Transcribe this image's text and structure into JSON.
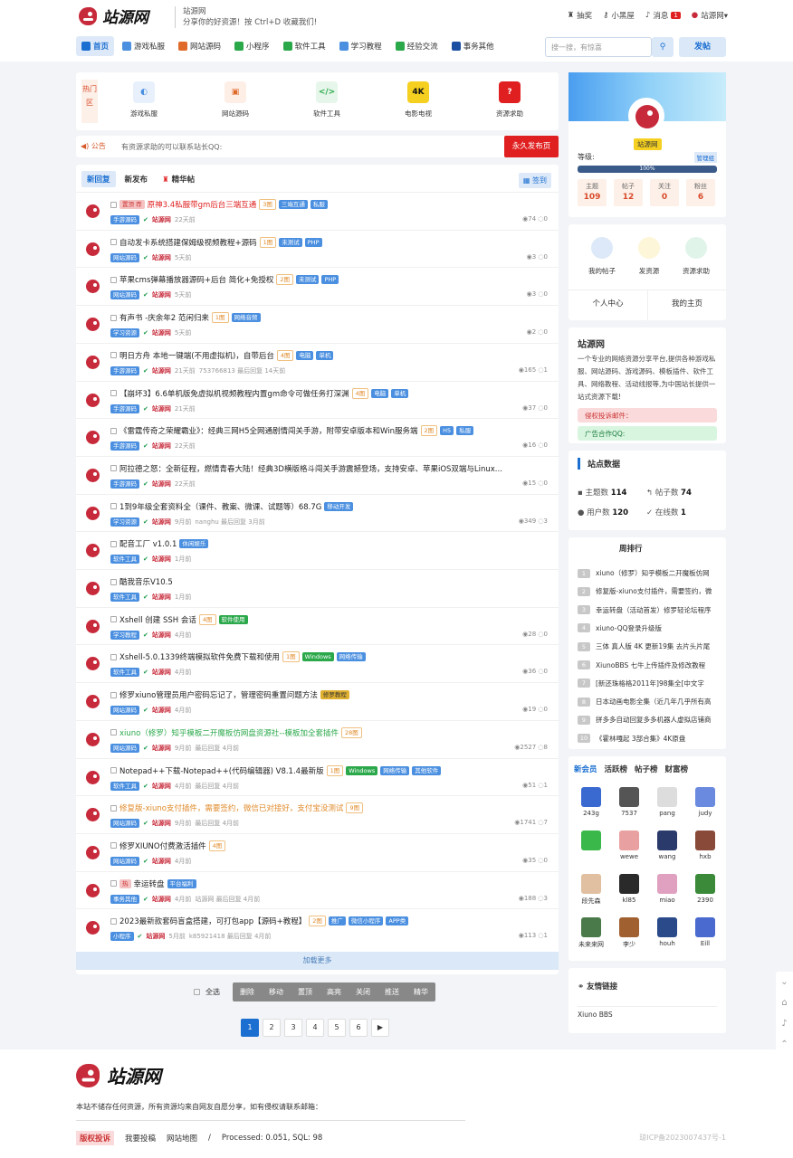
{
  "brand": {
    "name": "站源网",
    "slogan1": "站源网",
    "slogan2": "分享你的好资源！按 Ctrl+D 收藏我们!",
    "color": "#c72a3a"
  },
  "toplinks": {
    "lottery": "抽奖",
    "blackroom": "小黑屋",
    "messages": "消息",
    "msg_count": "1",
    "user": "站源网▾"
  },
  "nav": [
    {
      "label": "首页",
      "color": "#1b6fd1"
    },
    {
      "label": "游戏私服",
      "color": "#4a8fe0"
    },
    {
      "label": "网站源码",
      "color": "#e06a2a"
    },
    {
      "label": "小程序",
      "color": "#2aa84a"
    },
    {
      "label": "软件工具",
      "color": "#2aa84a"
    },
    {
      "label": "学习教程",
      "color": "#4a8fe0"
    },
    {
      "label": "经验交流",
      "color": "#2aa84a"
    },
    {
      "label": "事务其他",
      "color": "#1b4fa1"
    }
  ],
  "search": {
    "placeholder": "搜一搜，有惊喜",
    "icon": "search-icon",
    "post_label": "发帖"
  },
  "hot": {
    "label": "热门区",
    "items": [
      {
        "label": "游戏私服",
        "glyph": "◐",
        "bg": "#e8f0fb",
        "fg": "#4a8fe0"
      },
      {
        "label": "网站源码",
        "glyph": "▣",
        "bg": "#fdeee6",
        "fg": "#e06a2a"
      },
      {
        "label": "软件工具",
        "glyph": "</>",
        "bg": "#e6f6ea",
        "fg": "#2aa84a"
      },
      {
        "label": "电影电视",
        "glyph": "4K",
        "bg": "#f5d020",
        "fg": "#111"
      },
      {
        "label": "资源求助",
        "glyph": "?",
        "bg": "#e02020",
        "fg": "#fff"
      }
    ]
  },
  "notice": {
    "label": "◀) 公告",
    "text": "有资源求助的可以联系站长QQ:",
    "button": "永久发布页"
  },
  "tabs": [
    "新回复",
    "新发布",
    "精华帖"
  ],
  "sign_label": "签到",
  "posts": [
    {
      "title": "原神3.4私服带gm后台三端互通",
      "prefix": "置顶 荐",
      "red": true,
      "tags": [
        "3图",
        "三端互通",
        "私服"
      ],
      "cat": "手游源码",
      "author": "站源网",
      "time": "22天前",
      "extra": "",
      "views": "74",
      "replies": "0"
    },
    {
      "title": "自动发卡系统搭建保姆级视频教程+源码",
      "prefix": "",
      "red": false,
      "tags": [
        "1图",
        "未测试",
        "PHP"
      ],
      "cat": "网站源码",
      "author": "站源网",
      "time": "5天前",
      "extra": "",
      "views": "3",
      "replies": "0"
    },
    {
      "title": "苹果cms弹幕播放器源码+后台 简化+免授权",
      "prefix": "",
      "red": false,
      "tags": [
        "2图",
        "未测试",
        "PHP"
      ],
      "cat": "网站源码",
      "author": "站源网",
      "time": "5天前",
      "extra": "",
      "views": "3",
      "replies": "0"
    },
    {
      "title": "有声书 -庆余年2 范闲归来",
      "prefix": "",
      "red": false,
      "tags": [
        "1图",
        "网络音频"
      ],
      "cat": "学习资源",
      "author": "站源网",
      "time": "5天前",
      "extra": "",
      "views": "2",
      "replies": "0"
    },
    {
      "title": "明日方舟 本地一键端(不用虚拟机)，自带后台",
      "prefix": "",
      "red": false,
      "tags": [
        "4图",
        "电脑",
        "单机"
      ],
      "cat": "手游源码",
      "author": "站源网",
      "time": "21天前",
      "extra": "753766813 最后回复 14天前",
      "views": "165",
      "replies": "1"
    },
    {
      "title": "【崩坏3】6.6单机版免虚拟机视频教程内置gm命令可做任务打深渊",
      "prefix": "",
      "red": false,
      "tags": [
        "4图",
        "电脑",
        "单机"
      ],
      "cat": "手游源码",
      "author": "站源网",
      "time": "21天前",
      "extra": "",
      "views": "37",
      "replies": "0"
    },
    {
      "title": "《雷霆传奇之荣耀霸业》：经典三网H5全网通剧情闯关手游，附带安卓版本和Win服务端",
      "prefix": "",
      "red": false,
      "tags": [
        "2图",
        "H5",
        "私服"
      ],
      "cat": "手游源码",
      "author": "站源网",
      "time": "22天前",
      "extra": "",
      "views": "16",
      "replies": "0"
    },
    {
      "title": "阿拉德之怒：全新征程，燃情青春大陆！经典3D横版格斗闯关手游震撼登场，支持安卓、苹果iOS双端与Linux...",
      "prefix": "",
      "red": false,
      "tags": [],
      "cat": "手游源码",
      "author": "站源网",
      "time": "22天前",
      "extra": "",
      "views": "15",
      "replies": "0"
    },
    {
      "title": "1到9年级全套资料全（课件、教案、微课、试题等）68.7G",
      "prefix": "",
      "red": false,
      "tags": [
        "移动开发"
      ],
      "cat": "学习资源",
      "author": "站源网",
      "time": "9月前",
      "extra": "nanghu 最后回复 3月前",
      "views": "349",
      "replies": "3"
    },
    {
      "title": "配音工厂 v1.0.1",
      "prefix": "",
      "red": false,
      "tags": [
        "休闲娱乐"
      ],
      "cat": "软件工具",
      "author": "站源网",
      "time": "1月前",
      "extra": "",
      "views": "",
      "replies": ""
    },
    {
      "title": "酷我音乐V10.5",
      "prefix": "",
      "red": false,
      "tags": [],
      "cat": "软件工具",
      "author": "站源网",
      "time": "1月前",
      "extra": "",
      "views": "",
      "replies": ""
    },
    {
      "title": "Xshell 创建 SSH 会话",
      "prefix": "",
      "red": false,
      "tags": [
        "4图",
        "软件使用"
      ],
      "cat": "学习教程",
      "author": "站源网",
      "time": "4月前",
      "extra": "",
      "views": "28",
      "replies": "0"
    },
    {
      "title": "Xshell-5.0.1339终端模拟软件免费下载和使用",
      "prefix": "",
      "red": false,
      "tags": [
        "1图",
        "Windows",
        "网络传输"
      ],
      "cat": "软件工具",
      "author": "站源网",
      "time": "4月前",
      "extra": "",
      "views": "36",
      "replies": "0"
    },
    {
      "title": "修罗xiuno管理员用户密码忘记了，管理密码重置问题方法",
      "prefix": "",
      "red": false,
      "tags": [
        "修罗教程"
      ],
      "cat": "网站源码",
      "author": "站源网",
      "time": "4月前",
      "extra": "",
      "views": "19",
      "replies": "0"
    },
    {
      "title": "xiuno（修罗）知乎模板二开魔板仿网盘资源社--模板加全套插件",
      "prefix": "",
      "red": false,
      "green": true,
      "tags": [
        "28图"
      ],
      "cat": "网站源码",
      "author": "站源网",
      "time": "9月前",
      "extra": "最后回复 4月前",
      "views": "2527",
      "replies": "8"
    },
    {
      "title": "Notepad++下载-Notepad++(代码编辑器) V8.1.4最新版",
      "prefix": "",
      "red": false,
      "tags": [
        "1图",
        "Windows",
        "网络传输",
        "其他软件"
      ],
      "cat": "软件工具",
      "author": "站源网",
      "time": "4月前",
      "extra": "最后回复 4月前",
      "views": "51",
      "replies": "1"
    },
    {
      "title": "修复版-xiuno支付插件，需要签约，微信已对接好，支付宝没测试",
      "prefix": "",
      "red": false,
      "orange": true,
      "tags": [
        "9图"
      ],
      "cat": "网站源码",
      "author": "站源网",
      "time": "9月前",
      "extra": "最后回复 4月前",
      "views": "1741",
      "replies": "7"
    },
    {
      "title": "修罗XIUNO付费激活插件",
      "prefix": "",
      "red": false,
      "tags": [
        "4图"
      ],
      "cat": "网站源码",
      "author": "站源网",
      "time": "4月前",
      "extra": "",
      "views": "35",
      "replies": "0"
    },
    {
      "title": "幸运转盘",
      "prefix": "热",
      "red": false,
      "tags": [
        "平台福利"
      ],
      "cat": "事务其他",
      "author": "站源网",
      "time": "4月前",
      "extra": "站源网 最后回复 4月前",
      "views": "188",
      "replies": "3"
    },
    {
      "title": "2023最新款套码盲盒搭建，可打包app【源码+教程】",
      "prefix": "",
      "red": false,
      "tags": [
        "2图",
        "推广",
        "微信小程序",
        "APP类"
      ],
      "cat": "小程序",
      "author": "站源网",
      "time": "5月前",
      "extra": "k85921418 最后回复 4月前",
      "views": "113",
      "replies": "1"
    }
  ],
  "load_more": "加载更多",
  "batch": {
    "select_all": "全选",
    "actions": [
      "删除",
      "移动",
      "置顶",
      "高亮",
      "关闭",
      "推送",
      "精华"
    ]
  },
  "pager": [
    "1",
    "2",
    "3",
    "4",
    "5",
    "6",
    "▶"
  ],
  "profile": {
    "username": "站源网",
    "level_label": "等级:",
    "role": "管理组",
    "progress": "100%",
    "stats": [
      {
        "label": "主题",
        "value": "109"
      },
      {
        "label": "帖子",
        "value": "12"
      },
      {
        "label": "关注",
        "value": "0"
      },
      {
        "label": "粉丝",
        "value": "6"
      }
    ]
  },
  "quick": {
    "items": [
      {
        "label": "我的帖子",
        "color": "#dde9f8"
      },
      {
        "label": "发资源",
        "color": "#fdf6d8"
      },
      {
        "label": "资源求助",
        "color": "#e0f4ea"
      }
    ],
    "center": "个人中心",
    "home": "我的主页"
  },
  "about": {
    "title": "站源网",
    "text": "一个专业的网络资源分享平台,提供各种游戏私服、网站源码、游戏源码、模板插件、软件工具、网络教程、活动线报等,为中国站长提供一站式资源下载!",
    "report": "侵权投诉邮件：",
    "ads": "广告合作QQ:"
  },
  "site_stats": {
    "title": "站点数据",
    "topics_label": "主题数",
    "topics": "114",
    "posts_label": "帖子数",
    "posts": "74",
    "users_label": "用户数",
    "users": "120",
    "online_label": "在线数",
    "online": "1"
  },
  "weekly": {
    "tabs": [
      "周排行"
    ],
    "items": [
      {
        "n": "1",
        "t": "xiuno（修罗）知乎模板二开魔板仿网"
      },
      {
        "n": "2",
        "t": "修复版-xiuno支付插件，需要签约，微"
      },
      {
        "n": "3",
        "t": "幸运转盘（活动首发）修罗轻论坛程序"
      },
      {
        "n": "4",
        "t": "xiuno-QQ登录升级版"
      },
      {
        "n": "5",
        "t": "三体 真人版 4K 更新19集 去片头片尾"
      },
      {
        "n": "6",
        "t": "XiunoBBS 七牛上传插件及修改教程"
      },
      {
        "n": "7",
        "t": "[新还珠格格2011年]98集全[中文字"
      },
      {
        "n": "8",
        "t": "日本动画电影全集（近几年几乎所有高"
      },
      {
        "n": "9",
        "t": "拼多多自动回复多多机器人虚拟店铺商"
      },
      {
        "n": "10",
        "t": "《霍林嘎起 3部合集》4K原盘"
      }
    ]
  },
  "members": {
    "tabs": [
      "新会员",
      "活跃榜",
      "帖子榜",
      "财富榜"
    ],
    "list": [
      {
        "name": "243g",
        "c": "#3a6ad0"
      },
      {
        "name": "7537",
        "c": "#555"
      },
      {
        "name": "pang",
        "c": "#ddd"
      },
      {
        "name": "judy",
        "c": "#6a8ae0"
      },
      {
        "name": "",
        "c": "#3ab84a"
      },
      {
        "name": "wewe",
        "c": "#e8a0a0"
      },
      {
        "name": "wang",
        "c": "#2a3a6a"
      },
      {
        "name": "hxb",
        "c": "#8a4a3a"
      },
      {
        "name": "段先森",
        "c": "#e0c0a0"
      },
      {
        "name": "kl85",
        "c": "#2a2a2a"
      },
      {
        "name": "miao",
        "c": "#e0a0c0"
      },
      {
        "name": "2390",
        "c": "#3a8a3a"
      },
      {
        "name": "未来来网",
        "c": "#4a7a4a"
      },
      {
        "name": "李少",
        "c": "#a06030"
      },
      {
        "name": "houh",
        "c": "#2a4a8a"
      },
      {
        "name": "Eill",
        "c": "#4a6ad0"
      }
    ]
  },
  "links": {
    "title": "友情链接",
    "items": [
      "Xiuno BBS"
    ]
  },
  "footer": {
    "note": "本站不储存任何资源，所有资源均来自网友自愿分享，如有侵权请联系邮箱：",
    "copyright": "版权投诉",
    "submit": "我要投稿",
    "sitemap": "网站地图",
    "processed": "Processed: 0.051, SQL: 98",
    "icp": "琼ICP备2023007437号-1"
  }
}
